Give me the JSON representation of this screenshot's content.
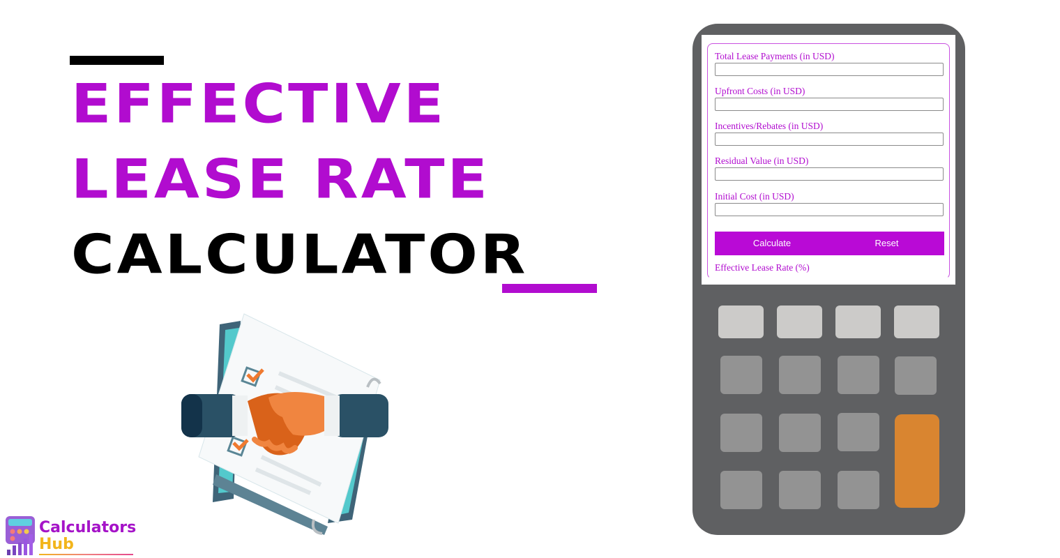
{
  "header": {
    "title_line1": "EFFECTIVE",
    "title_line2": "LEASE RATE",
    "title_line3": "CALCULATOR",
    "accent_color": "#b10ccf"
  },
  "illustration": {
    "icon": "handshake-contract-icon"
  },
  "brand": {
    "name_line1": "Calculators",
    "name_line2": "Hub",
    "icon": "calculator-chart-logo-icon"
  },
  "calculator": {
    "fields": [
      {
        "label": "Total Lease Payments (in USD)",
        "value": ""
      },
      {
        "label": "Upfront Costs (in USD)",
        "value": ""
      },
      {
        "label": "Incentives/Rebates (in USD)",
        "value": ""
      },
      {
        "label": "Residual Value (in USD)",
        "value": ""
      },
      {
        "label": "Initial Cost (in USD)",
        "value": ""
      }
    ],
    "calculate_label": "Calculate",
    "reset_label": "Reset",
    "result_label": "Effective Lease Rate (%)",
    "button_color": "#b90ad6",
    "keypad_colors": {
      "top_row": "#cccbc9",
      "keys": "#939393",
      "equals": "#d98530",
      "body": "#5f6062"
    }
  }
}
